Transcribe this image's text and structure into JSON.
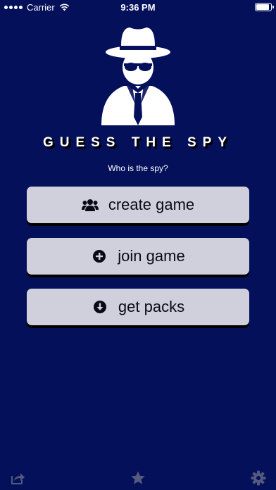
{
  "status_bar": {
    "carrier": "Carrier",
    "time": "9:36 PM"
  },
  "app": {
    "title": "GUESS THE SPY",
    "subtitle": "Who is the spy?"
  },
  "menu": {
    "create_label": "create game",
    "join_label": "join game",
    "packs_label": "get packs"
  },
  "icons": {
    "create": "group-icon",
    "join": "plus-circle-icon",
    "packs": "download-circle-icon",
    "share": "share-icon",
    "star": "star-icon",
    "settings": "gear-icon"
  },
  "colors": {
    "background": "#05105a",
    "button": "#cfd0dc",
    "bottom_icons": "#54597f"
  }
}
